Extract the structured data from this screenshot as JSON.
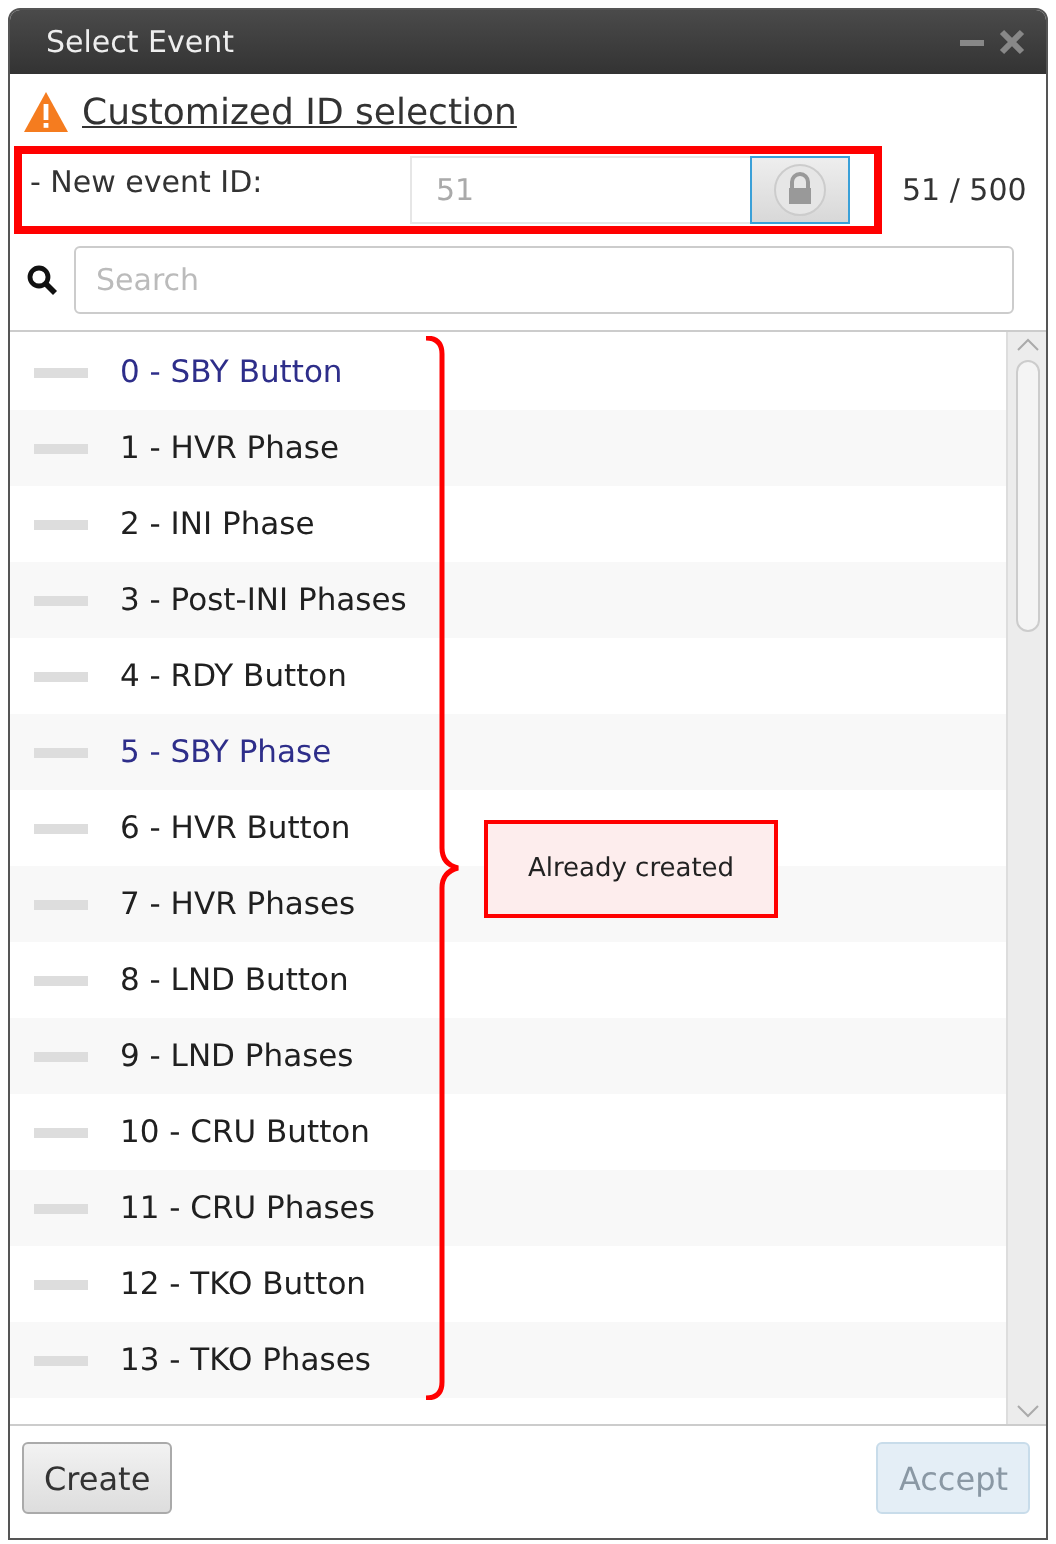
{
  "window": {
    "title": "Select Event"
  },
  "warning": {
    "text": "Customized ID selection"
  },
  "id_row": {
    "label": "- New event ID:",
    "value": "51",
    "locked": true,
    "count": "51 / 500"
  },
  "search": {
    "placeholder": "Search"
  },
  "events": [
    {
      "label": "0 - SBY Button",
      "color": "#2e2e8a"
    },
    {
      "label": "1 - HVR Phase",
      "color": "#202020"
    },
    {
      "label": "2 - INI Phase",
      "color": "#202020"
    },
    {
      "label": "3 - Post-INI Phases",
      "color": "#202020"
    },
    {
      "label": "4 - RDY Button",
      "color": "#202020"
    },
    {
      "label": "5 - SBY Phase",
      "color": "#2e2e8a"
    },
    {
      "label": "6 - HVR Button",
      "color": "#202020"
    },
    {
      "label": "7 - HVR Phases",
      "color": "#202020"
    },
    {
      "label": "8 - LND Button",
      "color": "#202020"
    },
    {
      "label": "9 - LND Phases",
      "color": "#202020"
    },
    {
      "label": "10 - CRU Button",
      "color": "#202020"
    },
    {
      "label": "11 - CRU Phases",
      "color": "#202020"
    },
    {
      "label": "12 - TKO Button",
      "color": "#202020"
    },
    {
      "label": "13 - TKO Phases",
      "color": "#202020"
    }
  ],
  "annotation": {
    "text": "Already created"
  },
  "buttons": [
    {
      "label": "Create",
      "disabled": false
    },
    {
      "label": "Accept",
      "disabled": true
    }
  ]
}
